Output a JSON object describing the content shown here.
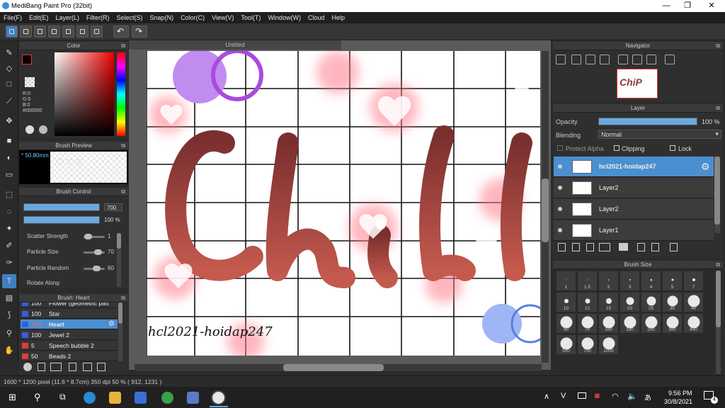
{
  "window": {
    "title": "MediBang Paint Pro (32bit)",
    "minimize": "—",
    "restore": "❐",
    "close": "✕"
  },
  "menu": [
    "File(F)",
    "Edit(E)",
    "Layer(L)",
    "Filter(R)",
    "Select(S)",
    "Snap(N)",
    "Color(C)",
    "View(V)",
    "Tool(T)",
    "Window(W)",
    "Cloud",
    "Help"
  ],
  "panels": {
    "color": "Color",
    "brush_preview": "Brush Preview",
    "brush_control": "Brush Control",
    "brush_list": "Brush: Heart",
    "navigator": "Navigator",
    "layer": "Layer",
    "brush_size": "Brush Size"
  },
  "color": {
    "r": "R:0",
    "g": "G:0",
    "b": "B:0",
    "hex": "#000000",
    "primary": "#000000",
    "secondary": "#ffffff"
  },
  "brush_preview": {
    "size": "* 50.80mm"
  },
  "brush_control": {
    "size_value": "700",
    "size_fill": 1.0,
    "opacity_value": "100 %",
    "opacity_fill": 1.0,
    "params": [
      {
        "label": "Scatter Strength",
        "value": "1",
        "level": 0.05
      },
      {
        "label": "Particle Size",
        "value": "70",
        "level": 0.7
      },
      {
        "label": "Particle Random",
        "value": "60",
        "level": 0.6
      }
    ],
    "rotate_label": "Rotate Along"
  },
  "brush_list": [
    {
      "size": "100",
      "name": "Flower (geometric patt",
      "color": "#3a5cd8",
      "selected": false
    },
    {
      "size": "100",
      "name": "Star",
      "color": "#3a5cd8",
      "selected": false
    },
    {
      "size": "700",
      "name": "Heart",
      "color": "#3a5cd8",
      "selected": true
    },
    {
      "size": "100",
      "name": "Jewel 2",
      "color": "#3a5cd8",
      "selected": false
    },
    {
      "size": "5",
      "name": "Speech bubble 2",
      "color": "#e03a3a",
      "selected": false
    },
    {
      "size": "50",
      "name": "Beads 2",
      "color": "#e03a3a",
      "selected": false
    }
  ],
  "document": {
    "tab": "Untitled",
    "watermark_text": "hcl2021-hoidap247",
    "title_text": "ChiP"
  },
  "layer_panel": {
    "opacity_label": "Opacity",
    "opacity_value": "100 %",
    "opacity_fill": 1.0,
    "blending_label": "Blending",
    "blending_value": "Normal",
    "protect_alpha": "Protect Alpha",
    "clipping": "Clipping",
    "lock": "Lock",
    "layers": [
      {
        "name": "hcl2021-hoidap247",
        "selected": true
      },
      {
        "name": "Layer2",
        "selected": false
      },
      {
        "name": "Layer2",
        "selected": false
      },
      {
        "name": "Layer1",
        "selected": false
      }
    ]
  },
  "brush_sizes": [
    {
      "label": "1",
      "d": 1
    },
    {
      "label": "1.5",
      "d": 1
    },
    {
      "label": "2",
      "d": 1.5
    },
    {
      "label": "3",
      "d": 2
    },
    {
      "label": "4",
      "d": 2.5
    },
    {
      "label": "5",
      "d": 3
    },
    {
      "label": "7",
      "d": 4
    },
    {
      "label": "10",
      "d": 6
    },
    {
      "label": "12",
      "d": 7
    },
    {
      "label": "15",
      "d": 8
    },
    {
      "label": "20",
      "d": 11
    },
    {
      "label": "25",
      "d": 13
    },
    {
      "label": "30",
      "d": 15
    },
    {
      "label": "40",
      "d": 17
    },
    {
      "label": "50",
      "d": 17
    },
    {
      "label": "70",
      "d": 17
    },
    {
      "label": "100",
      "d": 17
    },
    {
      "label": "150",
      "d": 17
    },
    {
      "label": "200",
      "d": 17
    },
    {
      "label": "300",
      "d": 17
    },
    {
      "label": "400",
      "d": 17
    },
    {
      "label": "500",
      "d": 17
    },
    {
      "label": "700",
      "d": 17
    },
    {
      "label": "1000",
      "d": 17
    }
  ],
  "status": {
    "text": "1600 * 1200 pixel  (11.6 * 8.7cm)  350 dpi  50 %  ( 912, 1231 )"
  },
  "taskbar": {
    "time": "9:56 PM",
    "date": "30/8/2021",
    "notif_count": "4",
    "start_icon": "windows-icon"
  }
}
